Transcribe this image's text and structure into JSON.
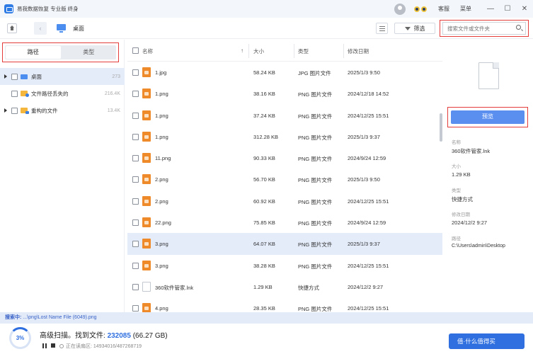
{
  "titlebar": {
    "app_title": "易我数据恢复 专业版 终身",
    "links": [
      "客服",
      "菜单"
    ],
    "window_buttons": [
      "—",
      "☐",
      "✕"
    ]
  },
  "toolbar": {
    "breadcrumb": "桌面",
    "back": "‹",
    "filter_label": "筛选",
    "search_placeholder": "搜索文件或文件夹"
  },
  "left_panel": {
    "tabs": [
      "路径",
      "类型"
    ],
    "tree": [
      {
        "label": "桌面",
        "count": "273",
        "expandable": true,
        "selected": true
      },
      {
        "label": "文件路径丢失的",
        "count": "216.4K",
        "expandable": false,
        "selected": false
      },
      {
        "label": "重构的文件",
        "count": "13.4K",
        "expandable": true,
        "selected": false
      }
    ]
  },
  "file_list": {
    "columns": [
      "名称",
      "大小",
      "类型",
      "修改日期"
    ],
    "sort_indicator": "↑",
    "rows": [
      {
        "name": "1.jpg",
        "size": "58.24 KB",
        "type": "JPG 图片文件",
        "date": "2025/1/3 9:50",
        "icon": "image",
        "selected": false
      },
      {
        "name": "1.png",
        "size": "38.16 KB",
        "type": "PNG 图片文件",
        "date": "2024/12/18 14:52",
        "icon": "image",
        "selected": false
      },
      {
        "name": "1.png",
        "size": "37.24 KB",
        "type": "PNG 图片文件",
        "date": "2024/12/25 15:51",
        "icon": "image",
        "selected": false
      },
      {
        "name": "1.png",
        "size": "312.28 KB",
        "type": "PNG 图片文件",
        "date": "2025/1/3 9:37",
        "icon": "image",
        "selected": false
      },
      {
        "name": "11.png",
        "size": "90.33 KB",
        "type": "PNG 图片文件",
        "date": "2024/9/24 12:59",
        "icon": "image",
        "selected": false
      },
      {
        "name": "2.png",
        "size": "56.70 KB",
        "type": "PNG 图片文件",
        "date": "2025/1/3 9:50",
        "icon": "image",
        "selected": false
      },
      {
        "name": "2.png",
        "size": "60.92 KB",
        "type": "PNG 图片文件",
        "date": "2024/12/25 15:51",
        "icon": "image",
        "selected": false
      },
      {
        "name": "22.png",
        "size": "75.85 KB",
        "type": "PNG 图片文件",
        "date": "2024/9/24 12:59",
        "icon": "image",
        "selected": false
      },
      {
        "name": "3.png",
        "size": "64.07 KB",
        "type": "PNG 图片文件",
        "date": "2025/1/3 9:37",
        "icon": "image",
        "selected": true
      },
      {
        "name": "3.png",
        "size": "38.28 KB",
        "type": "PNG 图片文件",
        "date": "2024/12/25 15:51",
        "icon": "image",
        "selected": false
      },
      {
        "name": "360软件管家.lnk",
        "size": "1.29 KB",
        "type": "快捷方式",
        "date": "2024/12/2 9:27",
        "icon": "shortcut",
        "selected": false
      },
      {
        "name": "4.png",
        "size": "28.35 KB",
        "type": "PNG 图片文件",
        "date": "2024/12/25 15:51",
        "icon": "image",
        "selected": false
      }
    ]
  },
  "details": {
    "preview_label": "预览",
    "fields": [
      {
        "label": "名称",
        "value": "360软件管家.lnk"
      },
      {
        "label": "大小",
        "value": "1.29 KB"
      },
      {
        "label": "类型",
        "value": "快捷方式"
      },
      {
        "label": "修改日期",
        "value": "2024/12/2 9:27"
      },
      {
        "label": "路径",
        "value": "C:\\Users\\admin\\Desktop"
      }
    ]
  },
  "status": {
    "scan_line_prefix": "搜索中:",
    "scan_line_path": "...\\png\\Lost Name File (6049).png",
    "progress": "3%",
    "progress_value": 0.03,
    "title_prefix": "高级扫描。找到文件:",
    "found_count": "232085",
    "found_size": "(66.27 GB)",
    "reading_label": "正在读扇区:",
    "reading_value": "14934016/487268719",
    "watermark": "值·什么值得买"
  },
  "colors": {
    "accent": "#2f6fe0",
    "highlight_box": "#e43b3b",
    "selection": "#e4ecfa",
    "image_icon": "#ef8a2a"
  }
}
